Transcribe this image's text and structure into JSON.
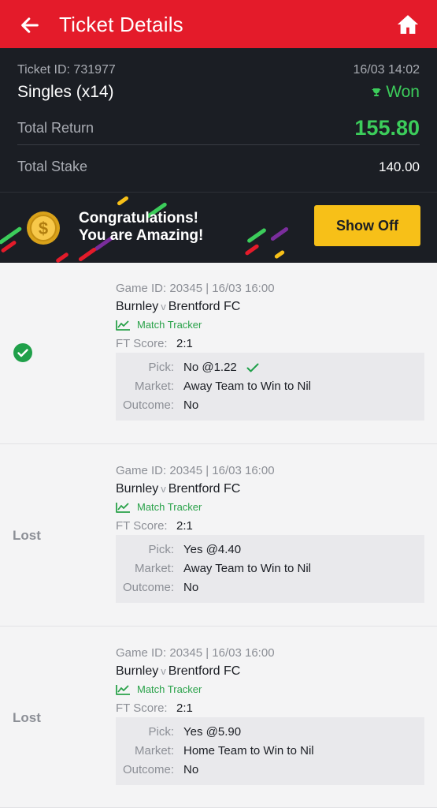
{
  "header": {
    "title": "Ticket Details"
  },
  "summary": {
    "ticket_id": "Ticket ID: 731977",
    "datetime": "16/03 14:02",
    "bet_type": "Singles (x14)",
    "status": "Won",
    "total_return_label": "Total Return",
    "total_return": "155.80",
    "total_stake_label": "Total Stake",
    "total_stake": "140.00"
  },
  "banner": {
    "line1": "Congratulations!",
    "line2": "You are Amazing!",
    "button": "Show Off"
  },
  "bets": [
    {
      "result": "won",
      "result_label": "",
      "game": "Game ID: 20345 | 16/03 16:00",
      "home": "Burnley",
      "vs": "v",
      "away": "Brentford FC",
      "tracker": "Match Tracker",
      "ft_label": "FT Score:",
      "ft_score": "2:1",
      "pick_label": "Pick:",
      "pick": "No @1.22",
      "market_label": "Market:",
      "market": "Away Team to Win to Nil",
      "outcome_label": "Outcome:",
      "outcome": "No"
    },
    {
      "result": "lost",
      "result_label": "Lost",
      "game": "Game ID: 20345 | 16/03 16:00",
      "home": "Burnley",
      "vs": "v",
      "away": "Brentford FC",
      "tracker": "Match Tracker",
      "ft_label": "FT Score:",
      "ft_score": "2:1",
      "pick_label": "Pick:",
      "pick": "Yes @4.40",
      "market_label": "Market:",
      "market": "Away Team to Win to Nil",
      "outcome_label": "Outcome:",
      "outcome": "No"
    },
    {
      "result": "lost",
      "result_label": "Lost",
      "game": "Game ID: 20345 | 16/03 16:00",
      "home": "Burnley",
      "vs": "v",
      "away": "Brentford FC",
      "tracker": "Match Tracker",
      "ft_label": "FT Score:",
      "ft_score": "2:1",
      "pick_label": "Pick:",
      "pick": "Yes @5.90",
      "market_label": "Market:",
      "market": "Home Team to Win to Nil",
      "outcome_label": "Outcome:",
      "outcome": "No"
    }
  ],
  "colors": {
    "brand_red": "#e41b2a",
    "dark_bg": "#1b1e24",
    "win_green": "#3ccd5b",
    "button_yellow": "#f7c018"
  },
  "icons": [
    "back-arrow-icon",
    "home-icon",
    "trophy-icon",
    "coin-icon",
    "check-circle-icon",
    "chart-line-icon",
    "check-icon"
  ]
}
